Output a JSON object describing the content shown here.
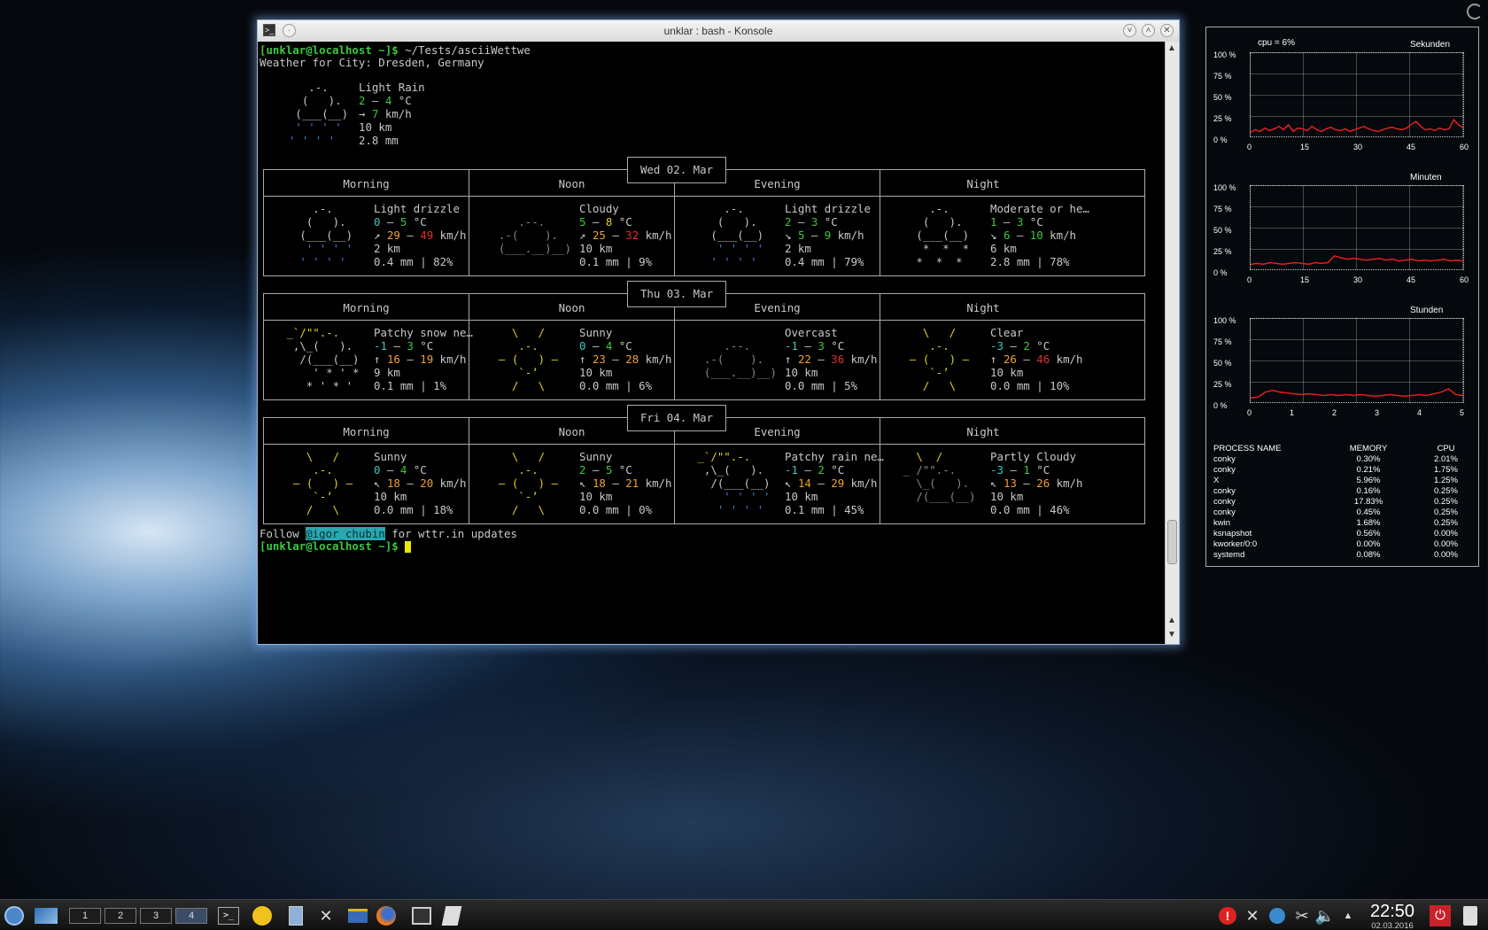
{
  "window": {
    "title": "unklar : bash - Konsole"
  },
  "terminal": {
    "prompt": "[unklar@localhost ~]$",
    "command": " ~/Tests/asciiWettwe",
    "city_line": "Weather for City: Dresden, Germany",
    "current": {
      "art": [
        "     .-.     ",
        "    (   ).   ",
        "   (___(__)  ",
        "   ' ' ' '   ",
        "  ' ' ' '    "
      ],
      "cond": "Light Rain",
      "temp_a": "2",
      "temp_b": "4",
      "temp_unit": " °C",
      "wind_arrow": "→",
      "wind": "7",
      "wind_unit": " km/h",
      "vis": "10 km",
      "prec": "2.8 mm"
    },
    "days": [
      {
        "date": "Wed 02. Mar",
        "periods": [
          {
            "name": "Morning",
            "art": [
              "     .-.   ",
              "    (   ). ",
              "   (___(__)",
              "    ' ' ' ' ",
              "   ' ' ' ' "
            ],
            "cond": "Light drizzle",
            "t1": "0",
            "t2": "5",
            "w_arrow": "↗",
            "w1": "29",
            "w2": "49",
            "vis": "2 km",
            "prec": "0.4 mm | 82%"
          },
          {
            "name": "Noon",
            "art": [
              "           ",
              "     .--.  ",
              "  .-(    ).",
              "  (___.__)__)",
              "           "
            ],
            "cond": "Cloudy",
            "t1": "5",
            "t2": "8",
            "w_arrow": "↗",
            "w1": "25",
            "w2": "32",
            "vis": "10 km",
            "prec": "0.1 mm | 9%"
          },
          {
            "name": "Evening",
            "art": [
              "     .-.   ",
              "    (   ). ",
              "   (___(__)",
              "    ' ' ' ' ",
              "   ' ' ' ' "
            ],
            "cond": "Light drizzle",
            "t1": "2",
            "t2": "3",
            "w_arrow": "↘",
            "w1": "5",
            "w2": "9",
            "vis": "2 km",
            "prec": "0.4 mm | 79%"
          },
          {
            "name": "Night",
            "art": [
              "     .-.   ",
              "    (   ). ",
              "   (___(__)",
              "    *  *  * ",
              "   *  *  * "
            ],
            "cond": "Moderate or he…",
            "t1": "1",
            "t2": "3",
            "w_arrow": "↘",
            "w1": "6",
            "w2": "10",
            "vis": "6 km",
            "prec": "2.8 mm | 78%"
          }
        ]
      },
      {
        "date": "Thu 03. Mar",
        "periods": [
          {
            "name": "Morning",
            "art": [
              " _`/\"\".-.  ",
              "  ,\\_(   ). ",
              "   /(___(__)",
              "     ' * ' *",
              "    * ' * ' "
            ],
            "cond": "Patchy snow ne…",
            "t1": "-1",
            "t2": "3",
            "w_arrow": "↑",
            "w1": "16",
            "w2": "19",
            "vis": "9 km",
            "prec": "0.1 mm | 1%"
          },
          {
            "name": "Noon",
            "art": [
              "    \\   /  ",
              "     .-.   ",
              "  ‒ (   ) ‒",
              "     `-’   ",
              "    /   \\  "
            ],
            "cond": "Sunny",
            "t1": "0",
            "t2": "4",
            "w_arrow": "↑",
            "w1": "23",
            "w2": "28",
            "vis": "10 km",
            "prec": "0.0 mm | 6%"
          },
          {
            "name": "Evening",
            "art": [
              "           ",
              "     .--.  ",
              "  .-(    ).",
              "  (___.__)__)",
              "           "
            ],
            "cond": "Overcast",
            "t1": "-1",
            "t2": "3",
            "w_arrow": "↑",
            "w1": "22",
            "w2": "36",
            "vis": "10 km",
            "prec": "0.0 mm | 5%"
          },
          {
            "name": "Night",
            "art": [
              "    \\   /  ",
              "     .-.   ",
              "  ‒ (   ) ‒",
              "     `-’   ",
              "    /   \\  "
            ],
            "cond": "Clear",
            "t1": "-3",
            "t2": "2",
            "w_arrow": "↑",
            "w1": "26",
            "w2": "46",
            "vis": "10 km",
            "prec": "0.0 mm | 10%"
          }
        ]
      },
      {
        "date": "Fri 04. Mar",
        "periods": [
          {
            "name": "Morning",
            "art": [
              "    \\   /  ",
              "     .-.   ",
              "  ‒ (   ) ‒",
              "     `-’   ",
              "    /   \\  "
            ],
            "cond": "Sunny",
            "t1": "0",
            "t2": "4",
            "w_arrow": "↖",
            "w1": "18",
            "w2": "20",
            "vis": "10 km",
            "prec": "0.0 mm | 18%"
          },
          {
            "name": "Noon",
            "art": [
              "    \\   /  ",
              "     .-.   ",
              "  ‒ (   ) ‒",
              "     `-’   ",
              "    /   \\  "
            ],
            "cond": "Sunny",
            "t1": "2",
            "t2": "5",
            "w_arrow": "↖",
            "w1": "18",
            "w2": "21",
            "vis": "10 km",
            "prec": "0.0 mm | 0%"
          },
          {
            "name": "Evening",
            "art": [
              " _`/\"\".-.  ",
              "  ,\\_(   ). ",
              "   /(___(__)",
              "     ' ' ' '",
              "    ' ' ' ' "
            ],
            "cond": "Patchy rain ne…",
            "t1": "-1",
            "t2": "2",
            "w_arrow": "↖",
            "w1": "14",
            "w2": "29",
            "vis": "10 km",
            "prec": "0.1 mm | 45%"
          },
          {
            "name": "Night",
            "art": [
              "   \\  /    ",
              " _ /\"\".-.   ",
              "   \\_(   ). ",
              "   /(___(__)",
              "           "
            ],
            "cond": "Partly Cloudy",
            "t1": "-3",
            "t2": "1",
            "w_arrow": "↖",
            "w1": "13",
            "w2": "26",
            "vis": "10 km",
            "prec": "0.0 mm | 46%"
          }
        ]
      }
    ],
    "follow_pre": "Follow ",
    "follow_handle": "@igor_chubin",
    "follow_post": " for wttr.in updates",
    "temp_dash": " – ",
    "unit_c": " °C",
    "unit_kmh": " km/h"
  },
  "conky": {
    "cpu_label": "cpu = 6%",
    "graphs": [
      {
        "title": "Sekunden",
        "xticks": [
          "0",
          "15",
          "30",
          "45",
          "60"
        ],
        "values": [
          5,
          8,
          6,
          10,
          7,
          9,
          12,
          8,
          14,
          6,
          10,
          9,
          7,
          12,
          8,
          6,
          9,
          11,
          8,
          7,
          9,
          6,
          8,
          10,
          12,
          9,
          7,
          6,
          8,
          10,
          11,
          9,
          8,
          10,
          14,
          18,
          12,
          8,
          9,
          7,
          10,
          8,
          9,
          20,
          14,
          10
        ]
      },
      {
        "title": "Minuten",
        "xticks": [
          "0",
          "15",
          "30",
          "45",
          "60"
        ],
        "values": [
          6,
          7,
          6,
          8,
          7,
          6,
          7,
          8,
          7,
          6,
          8,
          7,
          8,
          16,
          14,
          12,
          13,
          12,
          11,
          12,
          13,
          11,
          12,
          10,
          11,
          12,
          10,
          11,
          10,
          11,
          12,
          10,
          11,
          10
        ]
      },
      {
        "title": "Stunden",
        "xticks": [
          "0",
          "1",
          "2",
          "3",
          "4",
          "5"
        ],
        "values": [
          5,
          6,
          12,
          14,
          12,
          11,
          10,
          9,
          10,
          9,
          8,
          9,
          8,
          9,
          8,
          9,
          8,
          7,
          8,
          9,
          8,
          7,
          8,
          9,
          8,
          10,
          12,
          16,
          9,
          8
        ]
      }
    ],
    "yticks": [
      "100 %",
      "75 %",
      "50 %",
      "25 %",
      "0 %"
    ],
    "proc_header": {
      "name": "PROCESS NAME",
      "mem": "MEMORY",
      "cpu": "CPU"
    },
    "processes": [
      {
        "name": "conky",
        "mem": "0.30%",
        "cpu": "2.01%"
      },
      {
        "name": "conky",
        "mem": "0.21%",
        "cpu": "1.75%"
      },
      {
        "name": "X",
        "mem": "5.96%",
        "cpu": "1.25%"
      },
      {
        "name": "conky",
        "mem": "0.16%",
        "cpu": "0.25%"
      },
      {
        "name": "conky",
        "mem": "17.83%",
        "cpu": "0.25%"
      },
      {
        "name": "conky",
        "mem": "0.45%",
        "cpu": "0.25%"
      },
      {
        "name": "kwin",
        "mem": "1.68%",
        "cpu": "0.25%"
      },
      {
        "name": "ksnapshot",
        "mem": "0.56%",
        "cpu": "0.00%"
      },
      {
        "name": "kworker/0:0",
        "mem": "0.00%",
        "cpu": "0.00%"
      },
      {
        "name": "systemd",
        "mem": "0.08%",
        "cpu": "0.00%"
      }
    ]
  },
  "taskbar": {
    "desktops": [
      "1",
      "2",
      "3",
      "4"
    ],
    "active_desktop": "4",
    "clock_time": "22:50",
    "clock_date": "02.03.2016"
  }
}
